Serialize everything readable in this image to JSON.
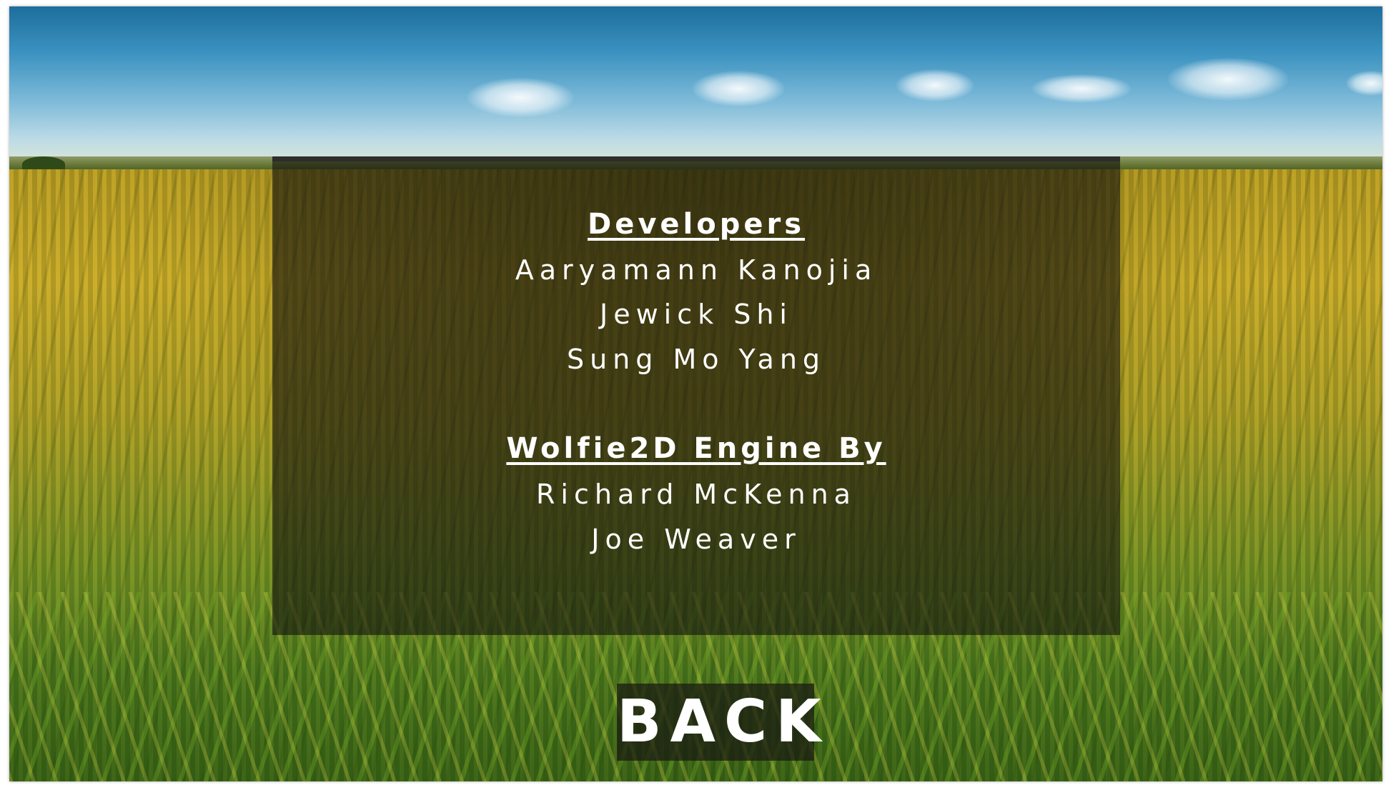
{
  "credits": {
    "developers_heading": "Developers",
    "developers": [
      "Aaryamann Kanojia",
      "Jewick Shi",
      "Sung Mo Yang"
    ],
    "engine_heading": "Wolfie2D Engine By",
    "engine_authors": [
      "Richard McKenna",
      "Joe Weaver"
    ]
  },
  "back_button": {
    "label": "BACK"
  },
  "colors": {
    "panel": "#14140e",
    "text": "#ffffff",
    "sky": "#3b92c0",
    "field": "#c7a827"
  }
}
